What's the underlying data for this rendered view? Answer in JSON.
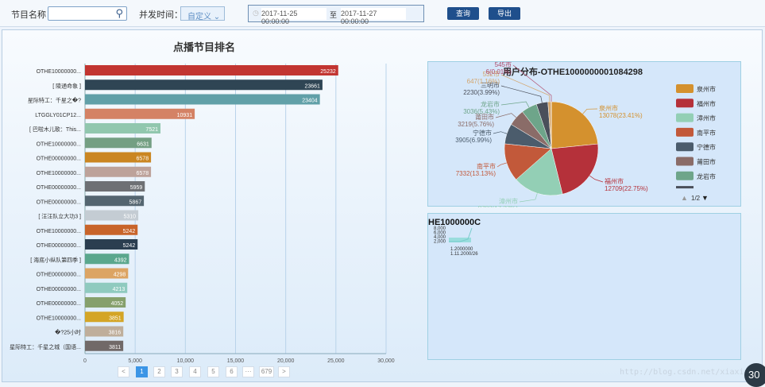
{
  "filters": {
    "program_name_label": "节目名称",
    "program_name_value": "",
    "concurrency_label": "并发时间：",
    "time_mode": "自定义",
    "start": "2017-11-25 00:00:00",
    "to": "至",
    "end": "2017-11-27 00:00:00",
    "query": "查询",
    "export": "导出"
  },
  "chart_data": [
    {
      "type": "bar",
      "orientation": "horizontal",
      "title": "点播节目排名",
      "xlim": [
        0,
        30000
      ],
      "xticks": [
        "0",
        "5,000",
        "10,000",
        "15,000",
        "20,000",
        "25,000",
        "30,000"
      ],
      "categories": [
        "OTHE10000000...",
        "[ 陵通命象 ]",
        "星际特工：千星之�?",
        "LTGGLY01CP12...",
        "[ 巴啦木儿歌：This...",
        "OTHE10000000...",
        "OTHE00000000...",
        "OTHE10000000...",
        "OTHE00000000...",
        "OTHE00000000...",
        "[ 汪汪队立大功3 ]",
        "OTHE10000000...",
        "OTHE00000000...",
        "[ 海底小纵队第四季 ]",
        "OTHE00000000...",
        "OTHE00000000...",
        "OTHE00000000...",
        "OTHE10000000...",
        "�?25小时",
        "星际特工：千星之城（国语..."
      ],
      "values": [
        25232,
        23661,
        23404,
        10931,
        7521,
        6631,
        6578,
        6578,
        5959,
        5867,
        5310,
        5242,
        5242,
        4392,
        4298,
        4213,
        4052,
        3851,
        3816,
        3811
      ],
      "colors": [
        "#c23531",
        "#2f4554",
        "#61a0a8",
        "#d48265",
        "#91c7ae",
        "#749f83",
        "#ca8622",
        "#bda29a",
        "#6e7074",
        "#546570",
        "#c4ccd3",
        "#c8642a",
        "#2b3e50",
        "#5aa78d",
        "#dca463",
        "#8fcabf",
        "#86a06c",
        "#d4a526",
        "#bfae9b",
        "#716968"
      ]
    },
    {
      "type": "pie",
      "title": "用户分布-OTHE1000000001084298",
      "slices": [
        {
          "name": "泉州市",
          "value": 13078,
          "pct": "23.41%",
          "color": "#d4912e"
        },
        {
          "name": "福州市",
          "value": 12709,
          "pct": "22.75%",
          "color": "#b5313a"
        },
        {
          "name": "漳州市",
          "value": 9703,
          "pct": "17.37%",
          "color": "#93cfb5"
        },
        {
          "name": "南平市",
          "value": 7332,
          "pct": "13.13%",
          "color": "#c2593a"
        },
        {
          "name": "宁德市",
          "value": 3905,
          "pct": "6.99%",
          "color": "#4b5c6c"
        },
        {
          "name": "莆田市",
          "value": 3219,
          "pct": "5.76%",
          "color": "#8a6c68"
        },
        {
          "name": "龙岩市",
          "value": 3036,
          "pct": "5.43%",
          "color": "#6ea58a"
        },
        {
          "name": "三明市",
          "value": 2230,
          "pct": "3.99%",
          "color": "#4a4f5a"
        },
        {
          "name": "532市",
          "value": 647,
          "pct": "1.16%",
          "color": "#d4a56b"
        },
        {
          "name": "545市",
          "value": 6,
          "pct": "0.01%",
          "color": "#b04a6a"
        }
      ],
      "legend_page": "1/2"
    },
    {
      "type": "line",
      "title": "HE1000000C",
      "yticks": [
        "8,000",
        "6,000",
        "4,000",
        "2,000"
      ],
      "xticks": [
        "1.2000000",
        "1.11.2000/26"
      ]
    }
  ],
  "pagination": {
    "pages": [
      "1",
      "2",
      "3",
      "4",
      "5",
      "6",
      "···",
      "679"
    ],
    "current": "1"
  },
  "watermark": "http://blog.csdn.net/xiaxian",
  "badge": "30"
}
